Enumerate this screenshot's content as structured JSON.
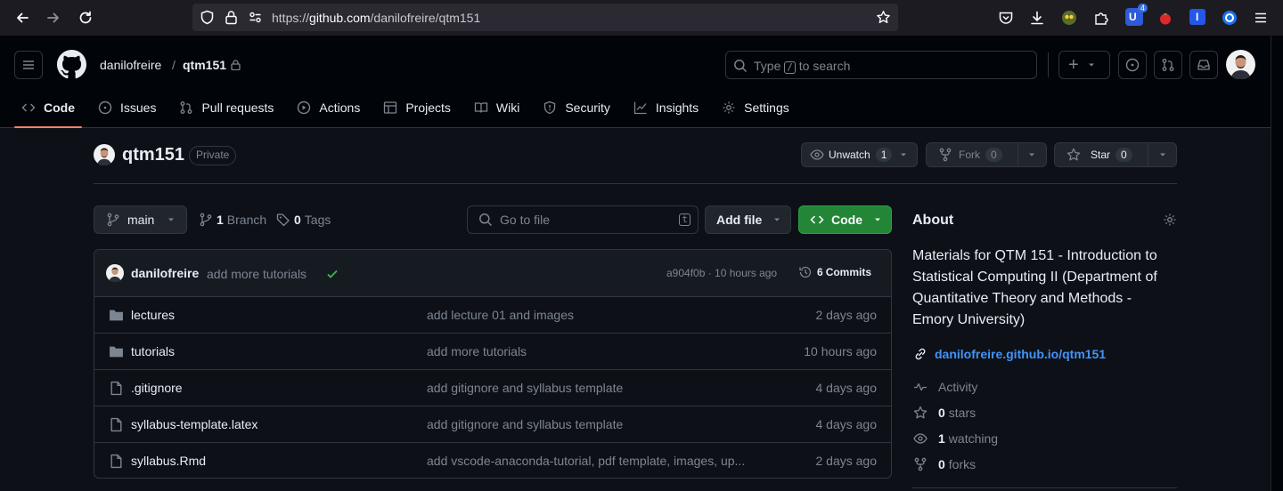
{
  "browser": {
    "url_prefix": "https://",
    "url_host": "github.com",
    "url_path": "/danilofreire/qtm151",
    "ext_badge": "4"
  },
  "header": {
    "owner": "danilofreire",
    "separator": "/",
    "repo": "qtm151",
    "search_prefix": "Type",
    "search_key": "/",
    "search_suffix": "to search",
    "new_label": "+"
  },
  "tabs": [
    {
      "label": "Code",
      "icon": "code-icon"
    },
    {
      "label": "Issues",
      "icon": "issue-icon"
    },
    {
      "label": "Pull requests",
      "icon": "pull-request-icon"
    },
    {
      "label": "Actions",
      "icon": "play-icon"
    },
    {
      "label": "Projects",
      "icon": "table-icon"
    },
    {
      "label": "Wiki",
      "icon": "book-icon"
    },
    {
      "label": "Security",
      "icon": "shield-icon"
    },
    {
      "label": "Insights",
      "icon": "graph-icon"
    },
    {
      "label": "Settings",
      "icon": "gear-icon"
    }
  ],
  "repo": {
    "name": "qtm151",
    "visibility": "Private",
    "watch_label": "Unwatch",
    "watch_count": "1",
    "fork_label": "Fork",
    "fork_count": "0",
    "star_label": "Star",
    "star_count": "0"
  },
  "toolbar": {
    "branch": "main",
    "branches_count": "1",
    "branches_label": "Branch",
    "tags_count": "0",
    "tags_label": "Tags",
    "goto_placeholder": "Go to file",
    "goto_key": "t",
    "add_file": "Add file",
    "code": "Code"
  },
  "commit": {
    "author": "danilofreire",
    "message": "add more tutorials",
    "hash_time": "a904f0b · 10 hours ago",
    "commits_count": "6",
    "commits_label": "Commits"
  },
  "files": [
    {
      "type": "folder",
      "name": "lectures",
      "message": "add lecture 01 and images",
      "age": "2 days ago"
    },
    {
      "type": "folder",
      "name": "tutorials",
      "message": "add more tutorials",
      "age": "10 hours ago"
    },
    {
      "type": "file",
      "name": ".gitignore",
      "message": "add gitignore and syllabus template",
      "age": "4 days ago"
    },
    {
      "type": "file",
      "name": "syllabus-template.latex",
      "message": "add gitignore and syllabus template",
      "age": "4 days ago"
    },
    {
      "type": "file",
      "name": "syllabus.Rmd",
      "message": "add vscode-anaconda-tutorial, pdf template, images, up...",
      "age": "2 days ago"
    }
  ],
  "about": {
    "title": "About",
    "description": "Materials for QTM 151 - Introduction to Statistical Computing II (Department of Quantitative Theory and Methods - Emory University)",
    "link": "danilofreire.github.io/qtm151",
    "activity": "Activity",
    "stars_count": "0",
    "stars_label": "stars",
    "watching_count": "1",
    "watching_label": "watching",
    "forks_count": "0",
    "forks_label": "forks"
  },
  "colors": {
    "accent_underline": "#f78166",
    "code_button": "#238636",
    "link": "#4493f8",
    "check": "#3fb950"
  }
}
